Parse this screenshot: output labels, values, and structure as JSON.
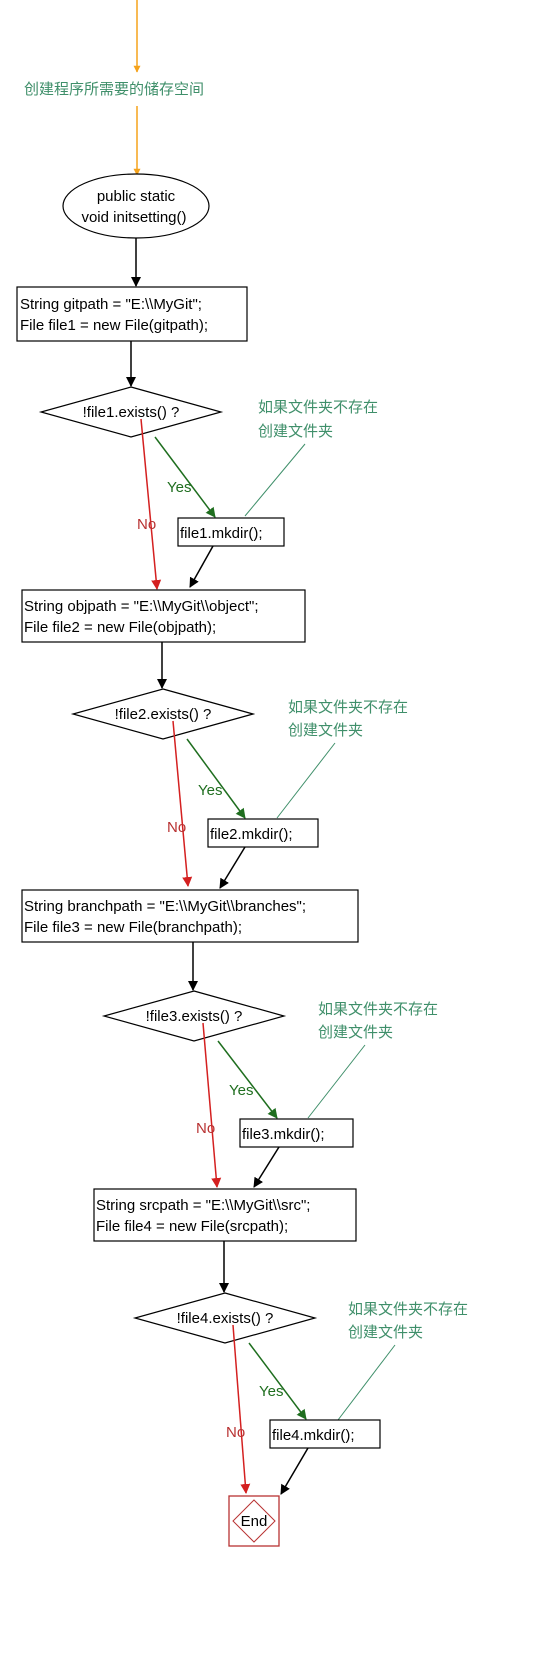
{
  "colors": {
    "orange": "#f5a21b",
    "black": "#000000",
    "green": "#1f6e1f",
    "red": "#d42020",
    "comment": "#3f8f6a",
    "end_border": "#b83232"
  },
  "intro_label": "创建程序所需要的储存空间",
  "start_node": {
    "line1": "public static",
    "line2": "void initsetting()"
  },
  "init_block": {
    "line1": "String gitpath = \"E:\\\\MyGit\";",
    "line2": "File file1 = new File(gitpath);"
  },
  "steps": [
    {
      "condition": "!file1.exists() ?",
      "yes_label": "Yes",
      "no_label": "No",
      "action": "file1.mkdir();",
      "comment_line1": "如果文件夹不存在",
      "comment_line2": "创建文件夹",
      "next_line1": "String objpath = \"E:\\\\MyGit\\\\object\";",
      "next_line2": "File file2 = new File(objpath);"
    },
    {
      "condition": "!file2.exists() ?",
      "yes_label": "Yes",
      "no_label": "No",
      "action": "file2.mkdir();",
      "comment_line1": "如果文件夹不存在",
      "comment_line2": "创建文件夹",
      "next_line1": "String branchpath = \"E:\\\\MyGit\\\\branches\";",
      "next_line2": "File file3 = new File(branchpath);"
    },
    {
      "condition": "!file3.exists() ?",
      "yes_label": "Yes",
      "no_label": "No",
      "action": "file3.mkdir();",
      "comment_line1": "如果文件夹不存在",
      "comment_line2": "创建文件夹",
      "next_line1": "String srcpath = \"E:\\\\MyGit\\\\src\";",
      "next_line2": "File file4 = new File(srcpath);"
    },
    {
      "condition": "!file4.exists() ?",
      "yes_label": "Yes",
      "no_label": "No",
      "action": "file4.mkdir();",
      "comment_line1": "如果文件夹不存在",
      "comment_line2": "创建文件夹"
    }
  ],
  "end_label": "End"
}
